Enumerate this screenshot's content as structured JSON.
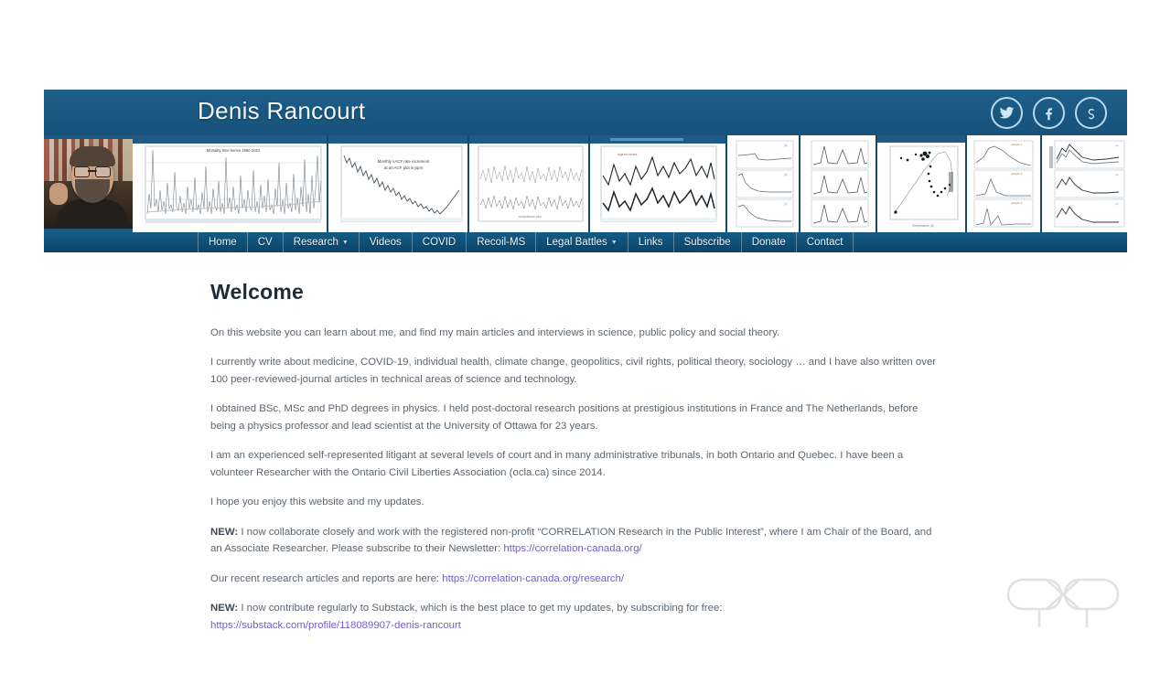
{
  "window": {
    "background": "#ffffff"
  },
  "header": {
    "title": "Denis Rancourt",
    "background": "#1b5a85",
    "socials": [
      {
        "name": "twitter-icon",
        "label": "Twitter"
      },
      {
        "name": "facebook-icon",
        "label": "Facebook"
      },
      {
        "name": "substack-icon",
        "label": "Substack"
      }
    ]
  },
  "banner": {
    "webcam_alt": "Video of Denis Rancourt speaking in front of a bookshelf",
    "thumbnails": [
      {
        "name": "spiky-timeseries-chart",
        "caption": "all-cause mortality time series"
      },
      {
        "name": "decay-curve-chart",
        "caption": "decaying curve"
      },
      {
        "name": "noisy-dual-band-chart",
        "caption": "noisy dual band series"
      },
      {
        "name": "seasonal-peaks-chart",
        "caption": "seasonal peaks series"
      },
      {
        "name": "stacked-decay-panels-chart",
        "caption": "stacked decay panels"
      },
      {
        "name": "spectra-panels-chart",
        "caption": "stacked spectra panels"
      },
      {
        "name": "scatter-loop-chart",
        "caption": "scatter with loop trend"
      },
      {
        "name": "stacked-peak-panels-chart",
        "caption": "stacked peak panels"
      },
      {
        "name": "stacked-spectra-chart",
        "caption": "stacked spectra curves"
      },
      {
        "name": "edge-panel-chart",
        "caption": "partial edge panel"
      }
    ]
  },
  "nav": {
    "background": "#0e4a6f",
    "items": [
      {
        "label": "Home",
        "caret": false
      },
      {
        "label": "CV",
        "caret": false
      },
      {
        "label": "Research",
        "caret": true
      },
      {
        "label": "Videos",
        "caret": false
      },
      {
        "label": "COVID",
        "caret": false
      },
      {
        "label": "Recoil-MS",
        "caret": false
      },
      {
        "label": "Legal Battles",
        "caret": true
      },
      {
        "label": "Links",
        "caret": false
      },
      {
        "label": "Subscribe",
        "caret": false
      },
      {
        "label": "Donate",
        "caret": false
      },
      {
        "label": "Contact",
        "caret": false
      }
    ],
    "caret_glyph": "▼"
  },
  "main": {
    "heading": "Welcome",
    "paragraphs": [
      {
        "text": "On this website you can learn about me, and find my main articles and interviews in science, public policy and social theory."
      },
      {
        "text": "I currently write about medicine, COVID-19, individual health, climate change, geopolitics, civil rights, political theory, sociology … and I have also written over 100 peer-reviewed-journal articles in technical areas of science and technology."
      },
      {
        "text": "I obtained BSc, MSc and PhD degrees in physics.  I held post-doctoral research positions at prestigious institutions in France and The Netherlands, before being a physics professor and lead scientist at the University of Ottawa for 23 years."
      },
      {
        "text": "I am an experienced self-represented litigant at several levels of court and in many administrative tribunals, in both Ontario and Quebec.  I have been a volunteer Researcher with the Ontario Civil Liberties Association (ocla.ca) since 2014."
      },
      {
        "text": "I hope you enjoy this website and my updates."
      }
    ],
    "new_block_1": {
      "tag": "NEW:",
      "text": " I now collaborate closely and work with the registered non-profit “CORRELATION Research in the Public Interest”, where I am Chair of the Board, and an Associate Researcher. Please subscribe to their Newsletter: ",
      "link": "https://correlation-canada.org/"
    },
    "research_line": {
      "text": "Our recent research articles and reports are here: ",
      "link": "https://correlation-canada.org/research/"
    },
    "new_block_2": {
      "tag": "NEW:",
      "text": " I now contribute regularly to Substack, which is the best place to get my updates, by subscribing for free:",
      "link": "https://substack.com/profile/118089907-denis-rancourt"
    },
    "link_color": "#6d5fd0"
  },
  "watermark": {
    "name": "rr-logo-watermark",
    "label": "ЯR"
  }
}
